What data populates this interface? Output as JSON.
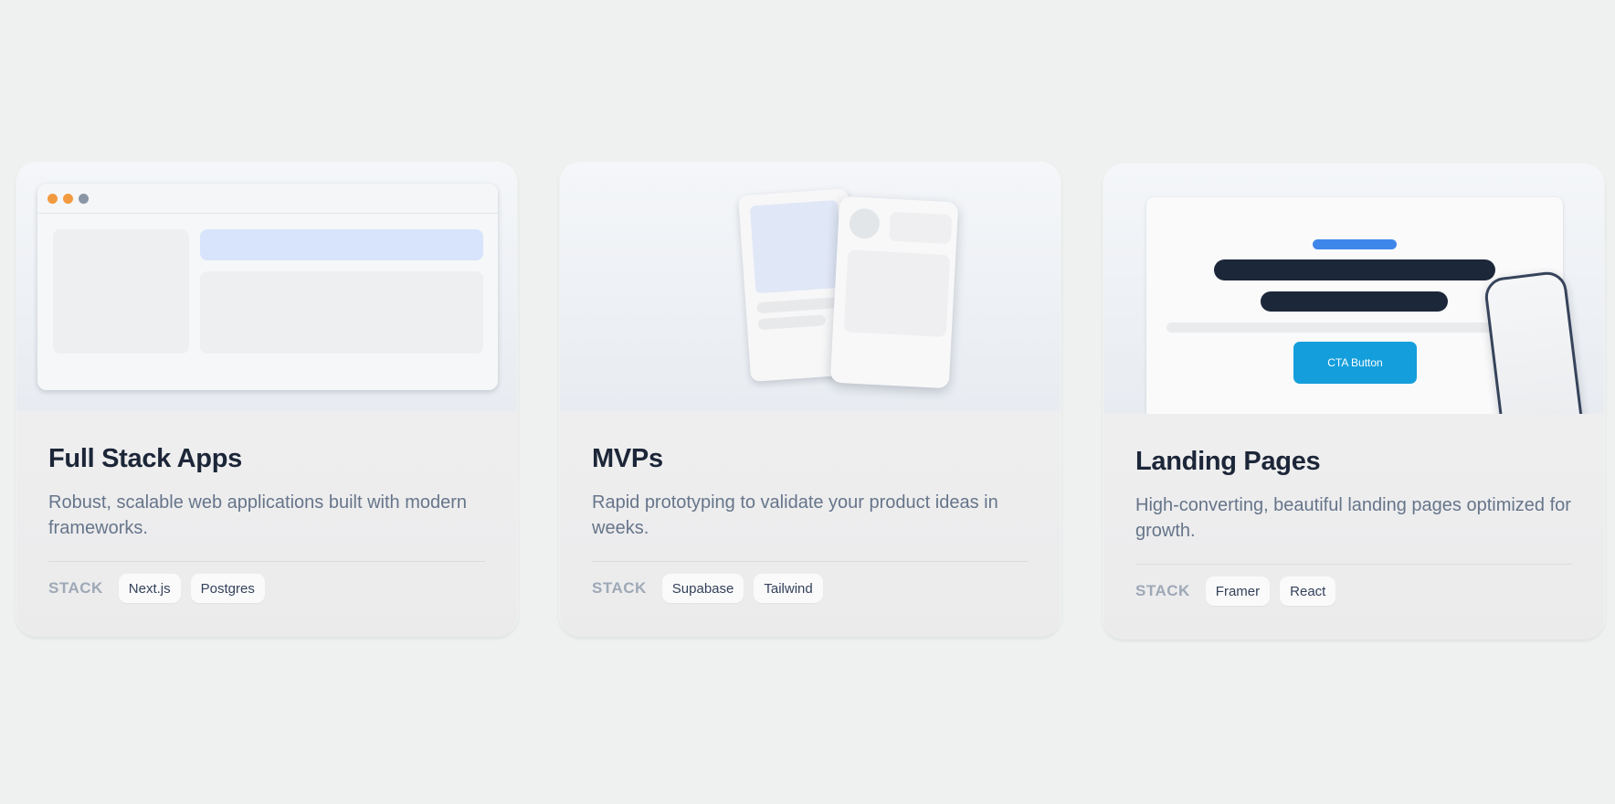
{
  "cards": [
    {
      "title": "Full Stack Apps",
      "description": "Robust, scalable web applications built with modern frameworks.",
      "stack_label": "STACK",
      "tags": [
        "Next.js",
        "Postgres"
      ]
    },
    {
      "title": "MVPs",
      "description": "Rapid prototyping to validate your product ideas in weeks.",
      "stack_label": "STACK",
      "tags": [
        "Supabase",
        "Tailwind"
      ]
    },
    {
      "title": "Landing Pages",
      "description": "High-converting, beautiful landing pages optimized for growth.",
      "stack_label": "STACK",
      "tags": [
        "Framer",
        "React"
      ],
      "preview_cta_label": "CTA Button"
    }
  ],
  "colors": {
    "page_background": "#eef1f0",
    "title": "#1c2638",
    "description": "#66758a",
    "accent_blue": "#3f86ea",
    "cta_blue": "#149edc",
    "window_dot_orange": "#f29a3f"
  }
}
